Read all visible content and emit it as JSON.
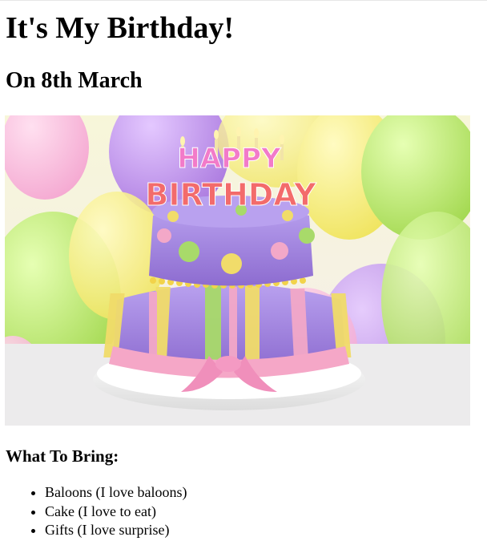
{
  "page": {
    "title": "It's My Birthday!",
    "subtitle": "On 8th March",
    "bring_heading": "What To Bring:",
    "bring_items": [
      "Baloons (I love baloons)",
      "Cake (I love to eat)",
      "Gifts (I love surprise)"
    ]
  },
  "image": {
    "cake_topper_line1": "HAPPY",
    "cake_topper_line2": "BIRTHDAY"
  },
  "colors": {
    "cake_purple": "#9b7fd6",
    "balloon_green": "#bde56b",
    "balloon_yellow": "#f2ef82",
    "balloon_purple": "#b98be3",
    "ribbon_pink": "#f5a7c7"
  }
}
